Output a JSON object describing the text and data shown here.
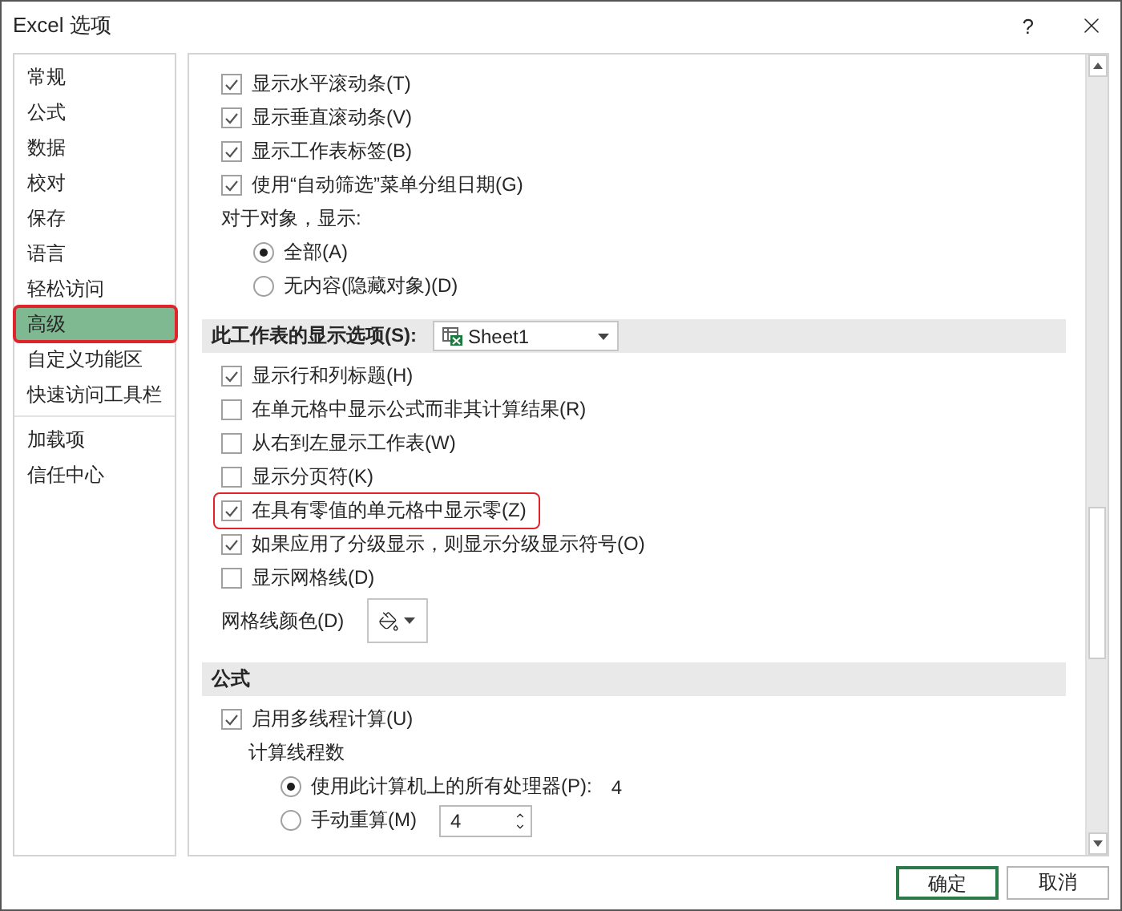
{
  "window": {
    "title": "Excel 选项",
    "help": "?"
  },
  "sidebar": {
    "groups": [
      {
        "items": [
          {
            "label": "常规",
            "selected": false,
            "highlighted": false
          },
          {
            "label": "公式",
            "selected": false,
            "highlighted": false
          },
          {
            "label": "数据",
            "selected": false,
            "highlighted": false
          },
          {
            "label": "校对",
            "selected": false,
            "highlighted": false
          },
          {
            "label": "保存",
            "selected": false,
            "highlighted": false
          },
          {
            "label": "语言",
            "selected": false,
            "highlighted": false
          },
          {
            "label": "轻松访问",
            "selected": false,
            "highlighted": false
          },
          {
            "label": "高级",
            "selected": true,
            "highlighted": true
          },
          {
            "label": "自定义功能区",
            "selected": false,
            "highlighted": false
          },
          {
            "label": "快速访问工具栏",
            "selected": false,
            "highlighted": false
          }
        ]
      },
      {
        "items": [
          {
            "label": "加载项",
            "selected": false,
            "highlighted": false
          },
          {
            "label": "信任中心",
            "selected": false,
            "highlighted": false
          }
        ]
      }
    ]
  },
  "sections": [
    {
      "items": [
        {
          "kind": "checkbox",
          "label": "显示水平滚动条(T)",
          "checked": true,
          "highlighted": false
        },
        {
          "kind": "checkbox",
          "label": "显示垂直滚动条(V)",
          "checked": true,
          "highlighted": false
        },
        {
          "kind": "checkbox",
          "label": "显示工作表标签(B)",
          "checked": true,
          "highlighted": false
        },
        {
          "kind": "checkbox",
          "label": "使用“自动筛选”菜单分组日期(G)",
          "checked": true,
          "highlighted": false
        },
        {
          "kind": "label",
          "label": "对于对象，显示:",
          "children": [
            {
              "kind": "radio",
              "label": "全部(A)",
              "selected": true
            },
            {
              "kind": "radio",
              "label": "无内容(隐藏对象)(D)",
              "selected": false
            }
          ]
        }
      ]
    },
    {
      "header": "此工作表的显示选项(S):",
      "dropdown": "Sheet1",
      "items": [
        {
          "kind": "checkbox",
          "label": "显示行和列标题(H)",
          "checked": true,
          "highlighted": false
        },
        {
          "kind": "checkbox",
          "label": "在单元格中显示公式而非其计算结果(R)",
          "checked": false,
          "highlighted": false
        },
        {
          "kind": "checkbox",
          "label": "从右到左显示工作表(W)",
          "checked": false,
          "highlighted": false
        },
        {
          "kind": "checkbox",
          "label": "显示分页符(K)",
          "checked": false,
          "highlighted": false
        },
        {
          "kind": "checkbox",
          "label": "在具有零值的单元格中显示零(Z)",
          "checked": true,
          "highlighted": true
        },
        {
          "kind": "checkbox",
          "label": "如果应用了分级显示，则显示分级显示符号(O)",
          "checked": true,
          "highlighted": false
        },
        {
          "kind": "checkbox",
          "label": "显示网格线(D)",
          "checked": false,
          "highlighted": false
        },
        {
          "kind": "color",
          "label": "网格线颜色(D)"
        }
      ]
    },
    {
      "header": "公式",
      "items": [
        {
          "kind": "checkbox",
          "label": "启用多线程计算(U)",
          "checked": true,
          "highlighted": false,
          "children": [
            {
              "kind": "label",
              "label": "计算线程数",
              "children": [
                {
                  "kind": "radio",
                  "label": "使用此计算机上的所有处理器(P):",
                  "selected": true,
                  "value": "4"
                },
                {
                  "kind": "radio",
                  "label": "手动重算(M)",
                  "selected": false,
                  "spinner": "4"
                }
              ]
            }
          ]
        }
      ]
    }
  ],
  "buttons": [
    {
      "label": "确定",
      "default": true
    },
    {
      "label": "取消",
      "default": false
    }
  ]
}
